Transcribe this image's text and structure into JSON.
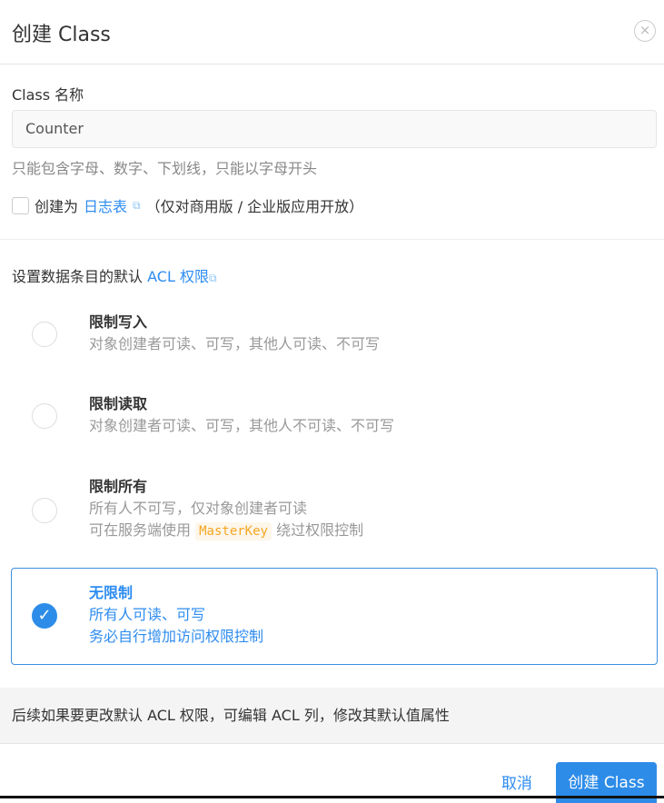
{
  "dialog": {
    "title": "创建 Class",
    "close_icon": "×"
  },
  "form": {
    "name_label": "Class 名称",
    "name_value": "Counter",
    "name_hint": "只能包含字母、数字、下划线，只能以字母开头",
    "log_prefix": "创建为",
    "log_link": "日志表",
    "log_suffix": "（仅对商用版 / 企业版应用开放）"
  },
  "acl": {
    "title_prefix": "设置数据条目的默认",
    "title_link": "ACL 权限",
    "options": [
      {
        "title": "限制写入",
        "line1": "对象创建者可读、可写，其他人可读、不可写",
        "selected": false
      },
      {
        "title": "限制读取",
        "line1": "对象创建者可读、可写，其他人不可读、不可写",
        "selected": false
      },
      {
        "title": "限制所有",
        "line1": "所有人不可写，仅对象创建者可读",
        "line2_prefix": "可在服务端使用",
        "line2_code": "MasterKey",
        "line2_suffix": "绕过权限控制",
        "selected": false
      },
      {
        "title": "无限制",
        "line1": "所有人可读、可写",
        "line2": "务必自行增加访问权限控制",
        "selected": true
      }
    ]
  },
  "note": "后续如果要更改默认 ACL 权限，可编辑 ACL 列，修改其默认值属性",
  "footer": {
    "cancel": "取消",
    "submit": "创建 Class"
  },
  "colors": {
    "accent": "#2d8ce8",
    "code": "#f5a623"
  }
}
